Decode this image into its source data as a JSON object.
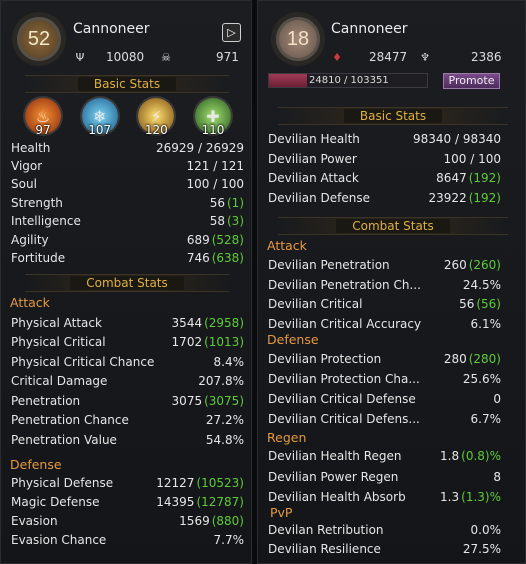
{
  "left": {
    "level": "52",
    "class": "Cannoneer",
    "chips": [
      {
        "icon": "trident-icon",
        "glyph": "Ψ",
        "value": "10080"
      },
      {
        "icon": "skull-icon",
        "glyph": "☠",
        "value": "971"
      }
    ],
    "basic_stats_title": "Basic Stats",
    "attributes": [
      {
        "name": "fire",
        "icon": "fire-icon",
        "glyph": "♨",
        "value": "97"
      },
      {
        "name": "ice",
        "icon": "frost-icon",
        "glyph": "❄",
        "value": "107"
      },
      {
        "name": "bolt",
        "icon": "lightning-icon",
        "glyph": "⚡",
        "value": "120"
      },
      {
        "name": "life",
        "icon": "nature-icon",
        "glyph": "✚",
        "value": "110"
      }
    ],
    "basic_stats": [
      {
        "label": "Health",
        "value": "26929 / 26929",
        "bonus": ""
      },
      {
        "label": "Vigor",
        "value": "121 / 121",
        "bonus": ""
      },
      {
        "label": "Soul",
        "value": "100 / 100",
        "bonus": ""
      },
      {
        "label": "Strength",
        "value": "56",
        "bonus": "(1)"
      },
      {
        "label": "Intelligence",
        "value": "58",
        "bonus": "(3)"
      },
      {
        "label": "Agility",
        "value": "689",
        "bonus": "(528)"
      },
      {
        "label": "Fortitude",
        "value": "746",
        "bonus": "(638)"
      }
    ],
    "combat_stats_title": "Combat Stats",
    "attack_title": "Attack",
    "attack": [
      {
        "label": "Physical Attack",
        "value": "3544",
        "bonus": "(2958)"
      },
      {
        "label": "Physical Critical",
        "value": "1702",
        "bonus": "(1013)"
      },
      {
        "label": "Physical Critical Chance",
        "value": "8.4%",
        "bonus": ""
      },
      {
        "label": "Critical Damage",
        "value": "207.8%",
        "bonus": ""
      },
      {
        "label": "Penetration",
        "value": "3075",
        "bonus": "(3075)"
      },
      {
        "label": "Penetration Chance",
        "value": "27.2%",
        "bonus": ""
      },
      {
        "label": "Penetration Value",
        "value": "54.8%",
        "bonus": ""
      }
    ],
    "defense_title": "Defense",
    "defense": [
      {
        "label": "Physical Defense",
        "value": "12127",
        "bonus": "(10523)"
      },
      {
        "label": "Magic Defense",
        "value": "14395",
        "bonus": "(12787)"
      },
      {
        "label": "Evasion",
        "value": "1569",
        "bonus": "(880)"
      },
      {
        "label": "Evasion Chance",
        "value": "7.7%",
        "bonus": ""
      }
    ]
  },
  "right": {
    "level": "18",
    "class": "Cannoneer",
    "chips": [
      {
        "icon": "demon-crest-icon",
        "glyph": "♦",
        "value": "28477"
      },
      {
        "icon": "demon-wings-icon",
        "glyph": "♆",
        "value": "2386"
      }
    ],
    "exp_text": "24810 / 103351",
    "exp_fraction": 0.24,
    "promote_label": "Promote",
    "basic_stats_title": "Basic Stats",
    "basic_stats": [
      {
        "label": "Devilian Health",
        "value": "98340 / 98340",
        "bonus": ""
      },
      {
        "label": "Devilian Power",
        "value": "100 / 100",
        "bonus": ""
      },
      {
        "label": "Devilian Attack",
        "value": "8647",
        "bonus": "(192)"
      },
      {
        "label": "Devilian Defense",
        "value": "23922",
        "bonus": "(192)"
      }
    ],
    "combat_stats_title": "Combat Stats",
    "attack_title": "Attack",
    "attack": [
      {
        "label": "Devilian Penetration",
        "value": "260",
        "bonus": "(260)"
      },
      {
        "label": "Devilian Penetration Ch...",
        "value": "24.5%",
        "bonus": ""
      },
      {
        "label": "Devilian Critical",
        "value": "56",
        "bonus": "(56)"
      },
      {
        "label": "Devilian Critical Accuracy",
        "value": "6.1%",
        "bonus": ""
      }
    ],
    "defense_title": "Defense",
    "defense": [
      {
        "label": "Devilian Protection",
        "value": "280",
        "bonus": "(280)"
      },
      {
        "label": "Devilian Protection Cha...",
        "value": "25.6%",
        "bonus": ""
      },
      {
        "label": "Devilian Critical Defense",
        "value": "0",
        "bonus": ""
      },
      {
        "label": "Devilian Critical Defens...",
        "value": "6.7%",
        "bonus": ""
      }
    ],
    "regen_title": "Regen",
    "regen": [
      {
        "label": "Devilian Health Regen",
        "value": "1.8",
        "bonus": "(0.8)%"
      },
      {
        "label": "Devilian Power Regen",
        "value": "8",
        "bonus": ""
      },
      {
        "label": "Devilian Health Absorb",
        "value": "1.3",
        "bonus": "(1.3)%"
      }
    ],
    "pvp_title": "PvP",
    "pvp": [
      {
        "label": "Devilan Retribution",
        "value": "0.0%",
        "bonus": ""
      },
      {
        "label": "Devilian Resilience",
        "value": "27.5%",
        "bonus": ""
      }
    ]
  }
}
